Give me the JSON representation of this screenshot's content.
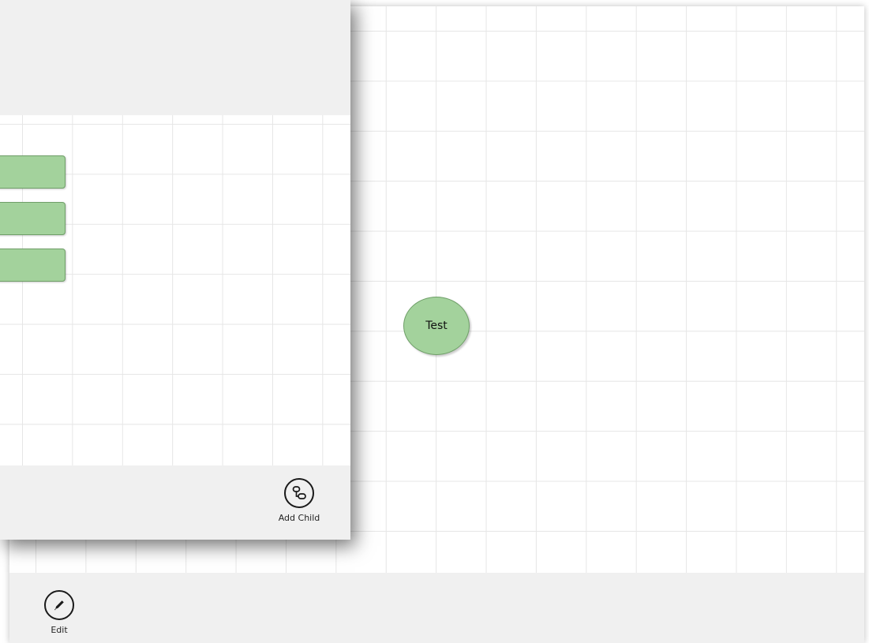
{
  "main_canvas": {
    "node_label": "Test"
  },
  "bottom_appbar": {
    "edit_label": "Edit",
    "edit_icon": "pencil-icon"
  },
  "child_dialog": {
    "add_child_label": "Add Child",
    "add_child_icon": "hierarchy-icon",
    "child_nodes": [
      "",
      "",
      ""
    ]
  },
  "colors": {
    "node_fill": "#a3d29c",
    "node_border": "#6f9f68",
    "appbar_bg": "#f0f0f0",
    "grid_line": "#e6e6e6"
  }
}
